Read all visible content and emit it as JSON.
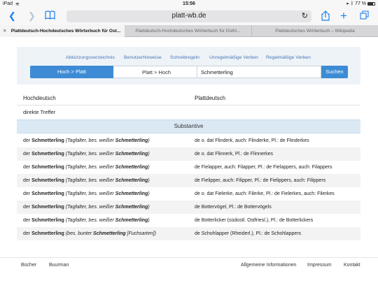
{
  "status": {
    "device": "iPad",
    "time": "15:56",
    "battery": "77 %"
  },
  "toolbar": {
    "url": "platt-wb.de"
  },
  "tabs": [
    {
      "label": "Plattdeutsch-Hochdeutsches Wörterbuch für Ost...",
      "active": true
    },
    {
      "label": "Plattdeutsch-Hochdeutsches Wörterbuch für Ostfri..."
    },
    {
      "label": "Plattdeutsches Wörterbuch – Wikipedia"
    }
  ],
  "nav": [
    "Abkürzungsverzeichnis",
    "Benutzerhinweise",
    "Schreibregeln",
    "Unregelmäßige Verben",
    "Regelmäßige Verben"
  ],
  "search": {
    "mode_active": "Hoch > Platt",
    "mode_other": "Platt > Hoch",
    "value": "Schmetterling",
    "button": "Suchen"
  },
  "results": {
    "col_hochdeutsch": "Hochdeutsch",
    "col_plattdeutsch": "Plattdeutsch",
    "subheader": "direkte Treffer",
    "section": "Substantive",
    "rows": [
      {
        "art": "der",
        "word": "Schmetterling",
        "note1": "(Tagfalter, bes. weißer",
        "note_word": "Schmetterling",
        "note2": ")",
        "platt": "de o. dat Flinderk, auch: Flinderke, Pl.: de Flinderkes"
      },
      {
        "art": "der",
        "word": "Schmetterling",
        "note1": "(Tagfalter, bes. weißer",
        "note_word": "Schmetterling",
        "note2": ")",
        "platt": "de o. dat Flinnerk, Pl.: de Flinnerkes"
      },
      {
        "art": "der",
        "word": "Schmetterling",
        "note1": "(Tagfalter, bes. weißer",
        "note_word": "Schmetterling",
        "note2": ")",
        "platt": "de Fielapper, auch: Filapper, Pl.: de Fielappers, auch: Filappers"
      },
      {
        "art": "der",
        "word": "Schmetterling",
        "note1": "(Tagfalter, bes. weißer",
        "note_word": "Schmetterling",
        "note2": ")",
        "platt": "de Fielipper, auch: Filipper, Pl.: de Fielippers, auch: Filippers"
      },
      {
        "art": "der",
        "word": "Schmetterling",
        "note1": "(Tagfalter, bes. weißer",
        "note_word": "Schmetterling",
        "note2": ")",
        "platt": "de o. dat Fielerke, auch: Filerke, Pl.: de Fielerkes, auch: Filerkes"
      },
      {
        "art": "der",
        "word": "Schmetterling",
        "note1": "(Tagfalter, bes. weißer",
        "note_word": "Schmetterling",
        "note2": ")",
        "platt": "de Bottervögel, Pl.: de Bottervögels"
      },
      {
        "art": "der",
        "word": "Schmetterling",
        "note1": "(Tagfalter, bes. weißer",
        "note_word": "Schmetterling",
        "note2": ")",
        "platt": "de Botterlicker (südostl. Ostfriesl.), Pl.: de Botterlickers"
      },
      {
        "art": "der",
        "word": "Schmetterling",
        "note1": "(bes. bunter",
        "note_word": "Schmetterling",
        "note2": "[Fuchsarten])",
        "platt": "de Schohlapper (Rheiderl.), Pl.: de Schohlappers"
      }
    ]
  },
  "footer": {
    "left": [
      "Bücher",
      "Buurman"
    ],
    "right": [
      "Allgemeine Informationen",
      "Impressum",
      "Kontakt"
    ]
  }
}
